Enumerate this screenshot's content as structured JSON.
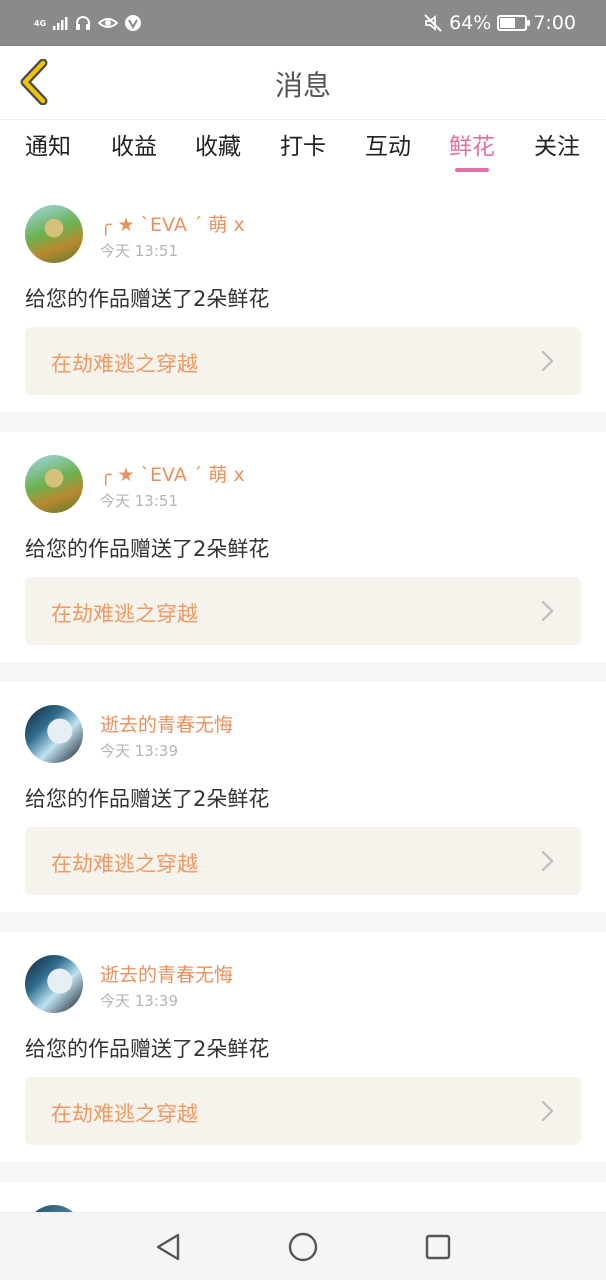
{
  "status_bar": {
    "network_label": "4G",
    "battery_percent_text": "64%",
    "battery_level": 0.64,
    "time": "7:00",
    "icons": [
      "signal-icon",
      "headset-icon",
      "eye-icon",
      "vpn-icon",
      "mute-icon",
      "battery-icon"
    ]
  },
  "header": {
    "title": "消息",
    "back_icon": "chevron-left-icon",
    "accent_color": "#f0c400"
  },
  "tabs": {
    "items": [
      "通知",
      "收益",
      "收藏",
      "打卡",
      "互动",
      "鲜花",
      "关注"
    ],
    "active": "鲜花",
    "active_color": "#e36fa5"
  },
  "messages": [
    {
      "nickname": "╭ ★ ˋEVA ˊ 萌 x",
      "time": "今天 13:51",
      "text": "给您的作品赠送了2朵鲜花",
      "work_title": "在劫难逃之穿越"
    },
    {
      "nickname": "╭ ★ ˋEVA ˊ 萌 x",
      "time": "今天 13:51",
      "text": "给您的作品赠送了2朵鲜花",
      "work_title": "在劫难逃之穿越"
    },
    {
      "nickname": "逝去的青春无悔",
      "time": "今天 13:39",
      "text": "给您的作品赠送了2朵鲜花",
      "work_title": "在劫难逃之穿越"
    },
    {
      "nickname": "逝去的青春无悔",
      "time": "今天 13:39",
      "text": "给您的作品赠送了2朵鲜花",
      "work_title": "在劫难逃之穿越"
    }
  ],
  "colors": {
    "nickname": "#e8915c",
    "work_title": "#ef9a63",
    "work_link_bg": "#f5f3ec"
  },
  "nav_bar": {
    "icons": [
      "back-triangle-icon",
      "home-circle-icon",
      "recents-square-icon"
    ]
  }
}
